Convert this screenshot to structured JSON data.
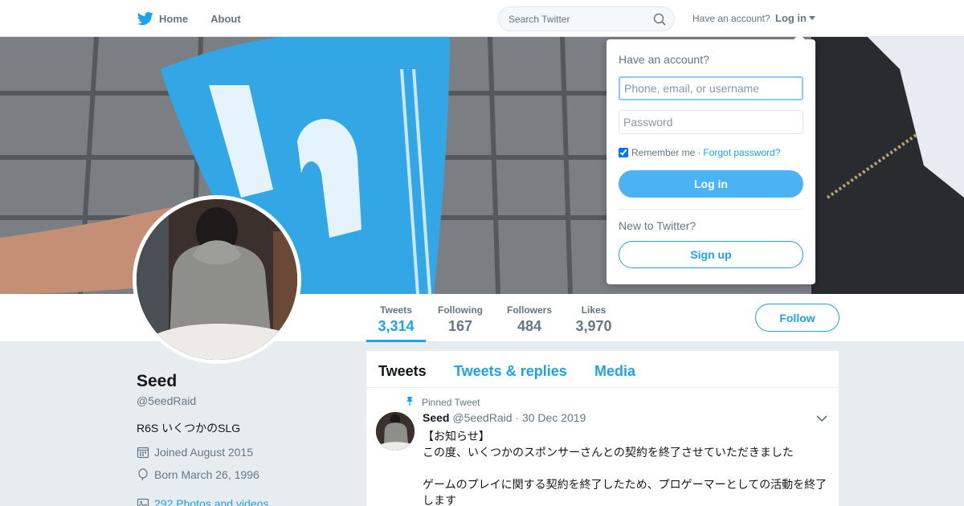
{
  "nav": {
    "home_label": "Home",
    "about_label": "About",
    "search_placeholder": "Search Twitter",
    "account_prompt": "Have an account?",
    "login_label": "Log in"
  },
  "profile": {
    "name": "Seed",
    "handle": "@5eedRaid",
    "bio": "R6S いくつかのSLG",
    "joined": "Joined August 2015",
    "born": "Born March 26, 1996",
    "photos_link": "292 Photos and videos"
  },
  "stats": [
    {
      "label": "Tweets",
      "value": "3,314"
    },
    {
      "label": "Following",
      "value": "167"
    },
    {
      "label": "Followers",
      "value": "484"
    },
    {
      "label": "Likes",
      "value": "3,970"
    }
  ],
  "follow_label": "Follow",
  "timeline": {
    "tabs": [
      {
        "label": "Tweets"
      },
      {
        "label": "Tweets & replies"
      },
      {
        "label": "Media"
      }
    ],
    "pinned_tweet": {
      "pinned_label": "Pinned Tweet",
      "name": "Seed",
      "handle": "@5eedRaid",
      "separator": "·",
      "date": "30 Dec 2019",
      "lines": [
        "【お知らせ】",
        "この度、いくつかのスポンサーさんとの契約を終了させていただきました",
        "",
        "ゲームのプレイに関する契約を終了したため、プロゲーマーとしての活動を終了します"
      ]
    }
  },
  "login_dropdown": {
    "heading": "Have an account?",
    "username_placeholder": "Phone, email, or username",
    "password_placeholder": "Password",
    "remember_label": "Remember me",
    "separator": "·",
    "forgot_label": "Forgot password?",
    "login_button": "Log in",
    "new_prompt": "New to Twitter?",
    "signup_button": "Sign up"
  },
  "colors": {
    "brand_blue": "#1da1f2",
    "login_button_blue": "#4ab3f4",
    "page_background": "#e6ecf0"
  }
}
